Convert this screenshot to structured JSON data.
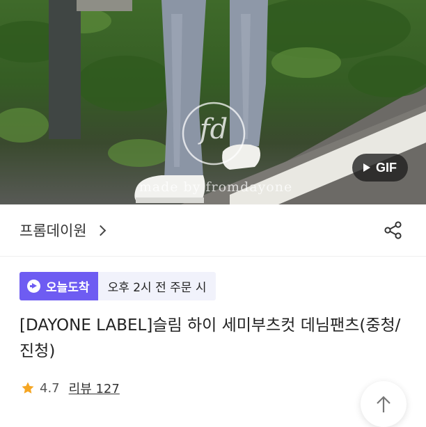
{
  "hero": {
    "watermark_logo": "fd",
    "watermark_text": "made by fromdayone",
    "gif_badge": "GIF"
  },
  "brand": {
    "name": "프롬데이원"
  },
  "delivery": {
    "badge_label": "오늘도착",
    "badge_note": "오후 2시 전 주문 시",
    "badge_color": "#6e5cf2"
  },
  "product": {
    "title": "[DAYONE LABEL]슬림 하이 세미부츠컷 데님팬츠(중청/진청)"
  },
  "rating": {
    "score": "4.7",
    "review_label": "리뷰 127",
    "star_color": "#f5a623"
  },
  "icons": {
    "share": "share-icon",
    "chevron": "chevron-right-icon",
    "scroll_top": "arrow-up-icon",
    "star": "star-icon",
    "gif_play": "play-icon"
  }
}
